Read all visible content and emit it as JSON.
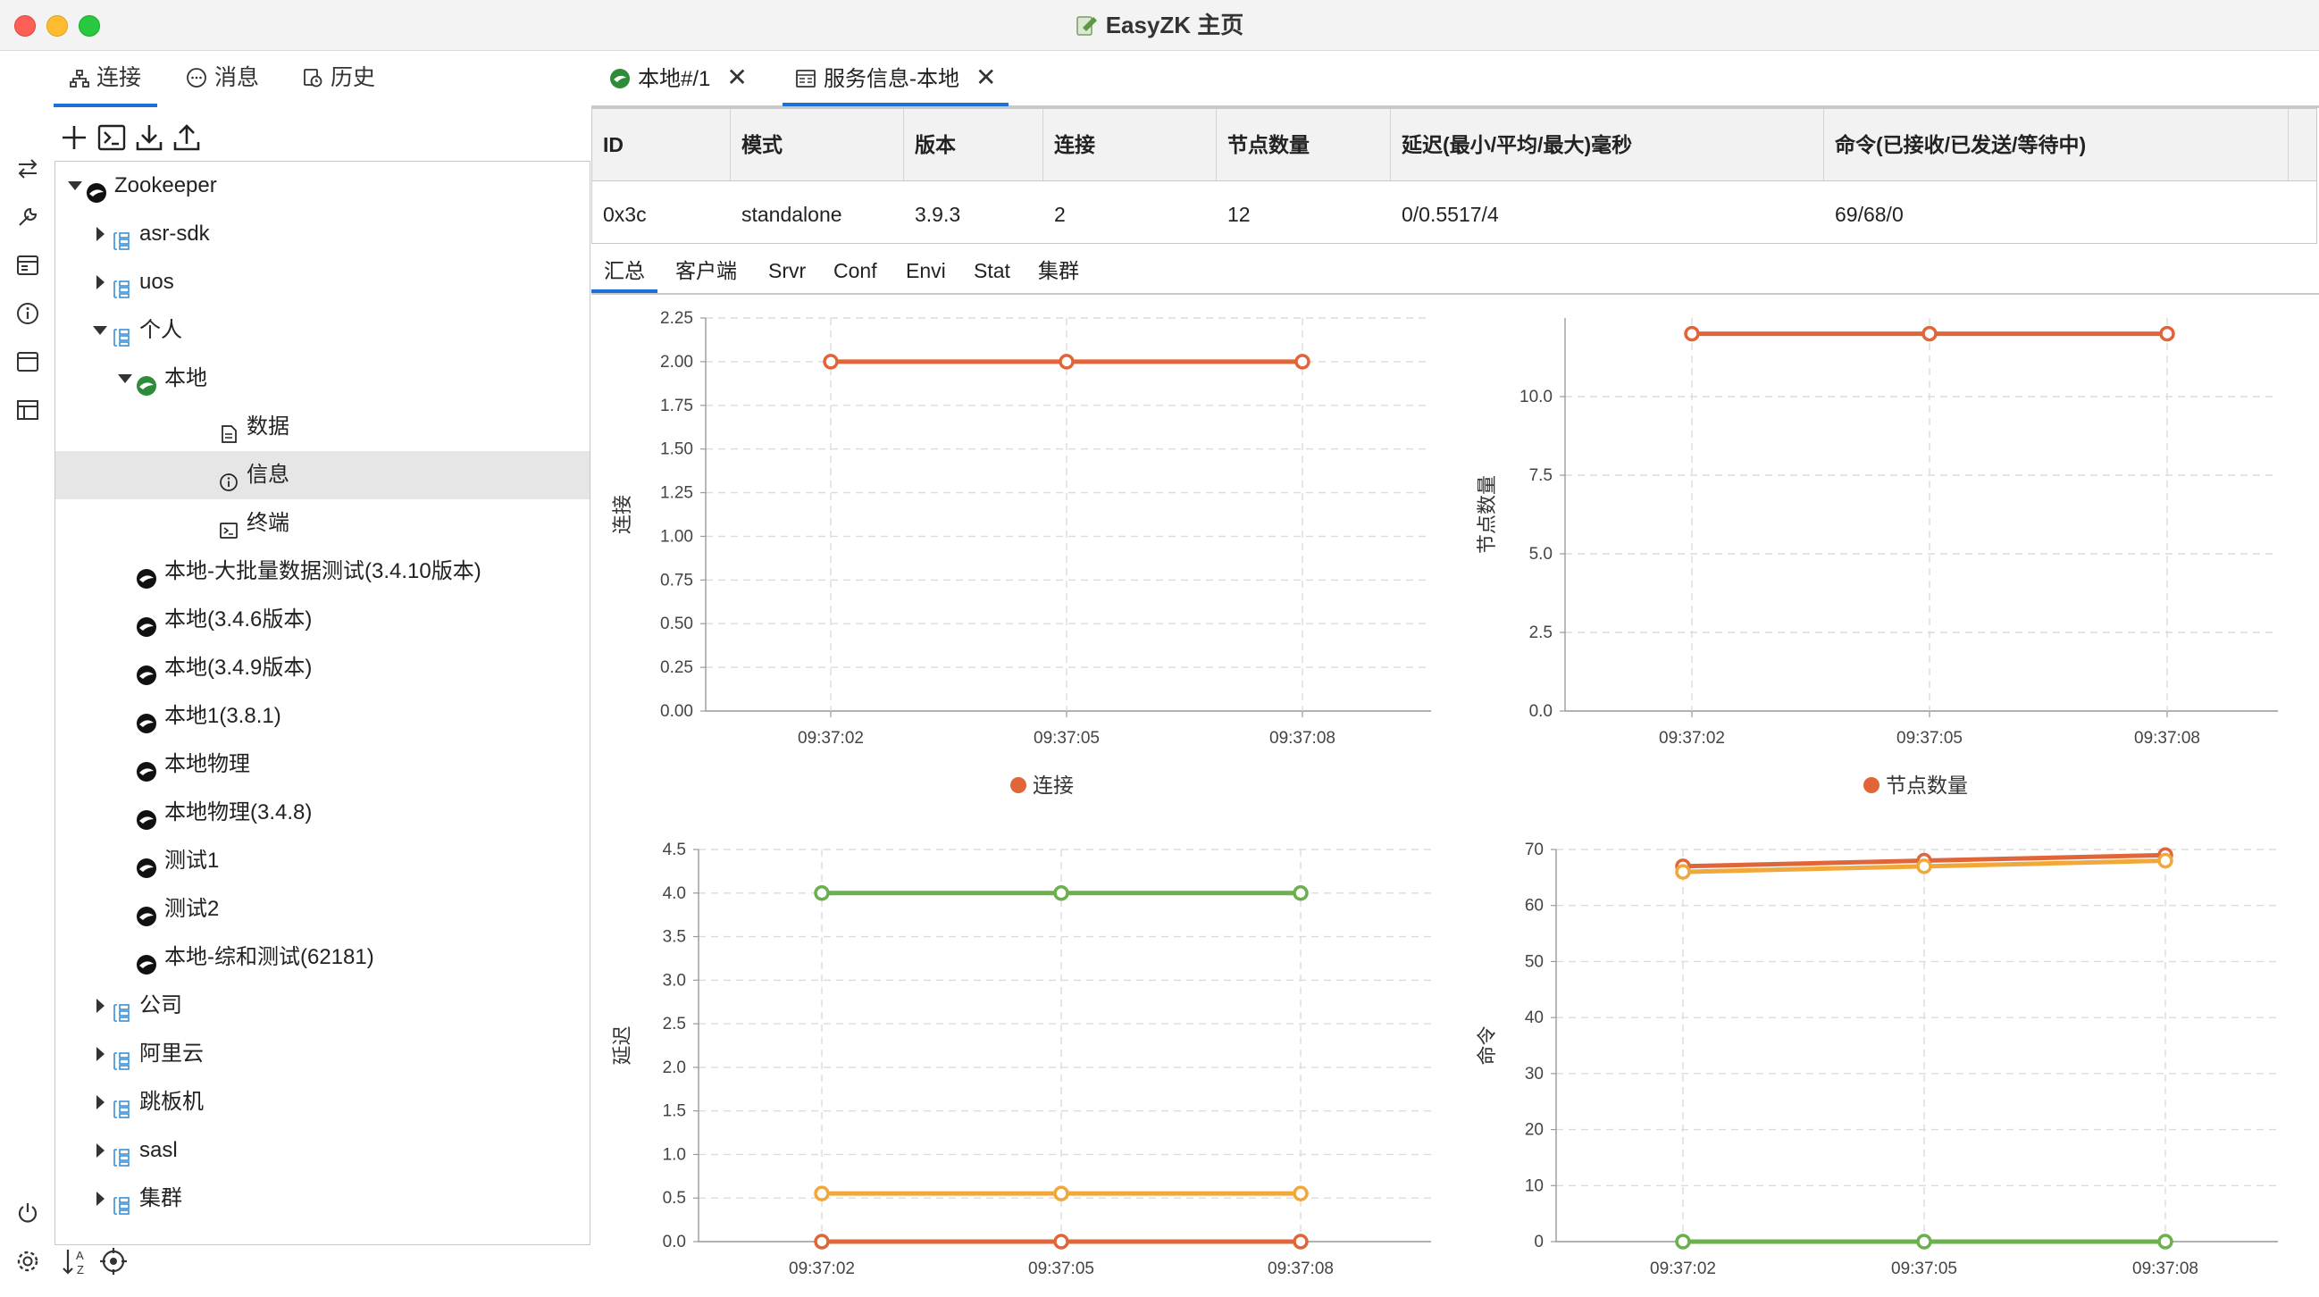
{
  "window": {
    "title": "EasyZK 主页"
  },
  "left_tabs": [
    {
      "label": "连接",
      "icon": "connection-tree-icon"
    },
    {
      "label": "消息",
      "icon": "message-icon"
    },
    {
      "label": "历史",
      "icon": "history-icon"
    }
  ],
  "side_icons": [
    "swap-icon",
    "wrench-icon",
    "server-window-icon",
    "info-icon",
    "window-icon",
    "layout-icon"
  ],
  "bottom_icons": [
    "power-icon",
    "settings-icon",
    "sort-az-icon",
    "locate-icon"
  ],
  "tree_toolbar": [
    "add-icon",
    "terminal-icon",
    "download-icon",
    "upload-icon"
  ],
  "tree": [
    {
      "label": "Zookeeper",
      "level": 0,
      "expanded": true,
      "icon": "zookeeper-icon"
    },
    {
      "label": "asr-sdk",
      "level": 1,
      "expanded": false,
      "icon": "group-icon"
    },
    {
      "label": "uos",
      "level": 1,
      "expanded": false,
      "icon": "group-icon"
    },
    {
      "label": "个人",
      "level": 1,
      "expanded": true,
      "icon": "group-icon"
    },
    {
      "label": "本地",
      "level": 2,
      "expanded": true,
      "icon": "connected-icon"
    },
    {
      "label": "数据",
      "level": 3,
      "icon": "data-icon"
    },
    {
      "label": "信息",
      "level": 3,
      "icon": "info-icon",
      "selected": true
    },
    {
      "label": "终端",
      "level": 3,
      "icon": "terminal-icon"
    },
    {
      "label": "本地-大批量数据测试(3.4.10版本)",
      "level": 2,
      "icon": "zookeeper-icon"
    },
    {
      "label": "本地(3.4.6版本)",
      "level": 2,
      "icon": "zookeeper-icon"
    },
    {
      "label": "本地(3.4.9版本)",
      "level": 2,
      "icon": "zookeeper-icon"
    },
    {
      "label": "本地1(3.8.1)",
      "level": 2,
      "icon": "zookeeper-icon"
    },
    {
      "label": "本地物理",
      "level": 2,
      "icon": "zookeeper-icon"
    },
    {
      "label": "本地物理(3.4.8)",
      "level": 2,
      "icon": "zookeeper-icon"
    },
    {
      "label": "测试1",
      "level": 2,
      "icon": "zookeeper-icon"
    },
    {
      "label": "测试2",
      "level": 2,
      "icon": "zookeeper-icon"
    },
    {
      "label": "本地-综和测试(62181)",
      "level": 2,
      "icon": "zookeeper-icon"
    },
    {
      "label": "公司",
      "level": 1,
      "expanded": false,
      "icon": "group-icon"
    },
    {
      "label": "阿里云",
      "level": 1,
      "expanded": false,
      "icon": "group-icon"
    },
    {
      "label": "跳板机",
      "level": 1,
      "expanded": false,
      "icon": "group-icon"
    },
    {
      "label": "sasl",
      "level": 1,
      "expanded": false,
      "icon": "group-icon"
    },
    {
      "label": "集群",
      "level": 1,
      "expanded": false,
      "icon": "group-icon"
    }
  ],
  "right_tabs": [
    {
      "label": "本地#/1",
      "icon": "connected-icon",
      "close": "✕"
    },
    {
      "label": "服务信息-本地",
      "icon": "server-info-icon",
      "close": "✕"
    }
  ],
  "info_table": {
    "headers": [
      "ID",
      "模式",
      "版本",
      "连接",
      "节点数量",
      "延迟(最小/平均/最大)毫秒",
      "命令(已接收/已发送/等待中)"
    ],
    "row": [
      "0x3c",
      "standalone",
      "3.9.3",
      "2",
      "12",
      "0/0.5517/4",
      "69/68/0"
    ]
  },
  "sub_tabs": [
    "汇总",
    "客户端",
    "Srvr",
    "Conf",
    "Envi",
    "Stat",
    "集群"
  ],
  "colors": {
    "accent": "#1e6fd9",
    "orange": "#e0663a",
    "yellow": "#f0a83a",
    "green": "#6ab04c"
  },
  "chart_data": [
    {
      "type": "line",
      "x": [
        "09:37:02",
        "09:37:05",
        "09:37:08"
      ],
      "ylabel": "连接",
      "ylim": [
        0,
        2.25
      ],
      "yticks": [
        "0.00",
        "0.25",
        "0.50",
        "0.75",
        "1.00",
        "1.25",
        "1.50",
        "1.75",
        "2.00",
        "2.25"
      ],
      "series": [
        {
          "name": "连接",
          "values": [
            2,
            2,
            2
          ],
          "color": "#e0663a"
        }
      ],
      "legend": "bottom",
      "grid": true
    },
    {
      "type": "line",
      "x": [
        "09:37:02",
        "09:37:05",
        "09:37:08"
      ],
      "ylabel": "节点数量",
      "ylim": [
        0,
        12.5
      ],
      "yticks": [
        "0.0",
        "2.5",
        "5.0",
        "7.5",
        "10.0"
      ],
      "series": [
        {
          "name": "节点数量",
          "values": [
            12,
            12,
            12
          ],
          "color": "#e0663a"
        }
      ],
      "legend": "bottom",
      "grid": true
    },
    {
      "type": "line",
      "x": [
        "09:37:02",
        "09:37:05",
        "09:37:08"
      ],
      "ylabel": "延迟",
      "ylim": [
        0,
        4.5
      ],
      "yticks": [
        "0.0",
        "0.5",
        "1.0",
        "1.5",
        "2.0",
        "2.5",
        "3.0",
        "3.5",
        "4.0",
        "4.5"
      ],
      "series": [
        {
          "values": [
            4,
            4,
            4
          ],
          "color": "#6ab04c"
        },
        {
          "values": [
            0.5517,
            0.5517,
            0.5517
          ],
          "color": "#f0a83a"
        },
        {
          "values": [
            0,
            0,
            0
          ],
          "color": "#e0663a"
        }
      ],
      "grid": true
    },
    {
      "type": "line",
      "x": [
        "09:37:02",
        "09:37:05",
        "09:37:08"
      ],
      "ylabel": "命令",
      "ylim": [
        0,
        70
      ],
      "yticks": [
        "0",
        "10",
        "20",
        "30",
        "40",
        "50",
        "60",
        "70"
      ],
      "series": [
        {
          "values": [
            67,
            68,
            69
          ],
          "color": "#e0663a"
        },
        {
          "values": [
            66,
            67,
            68
          ],
          "color": "#f0a83a"
        },
        {
          "values": [
            0,
            0,
            0
          ],
          "color": "#6ab04c"
        }
      ],
      "grid": true
    }
  ]
}
